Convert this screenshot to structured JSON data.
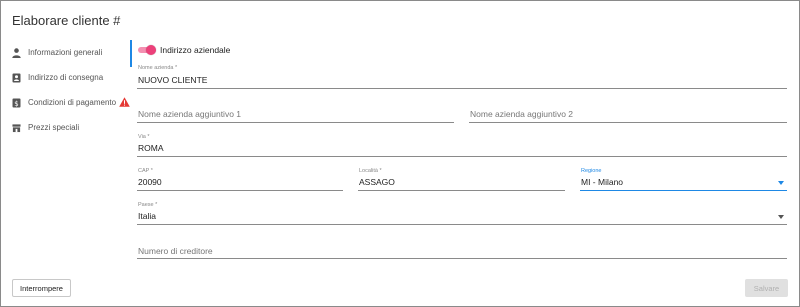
{
  "dialog": {
    "title": "Elaborare cliente #"
  },
  "sidebar": {
    "items": [
      {
        "label": "Informazioni generali",
        "icon": "person-icon"
      },
      {
        "label": "Indirizzo di consegna",
        "icon": "contact-card-icon"
      },
      {
        "label": "Condizioni di pagamento",
        "icon": "dollar-doc-icon",
        "warning_icon": "warning-icon"
      },
      {
        "label": "Prezzi speciali",
        "icon": "shop-icon"
      }
    ]
  },
  "form": {
    "toggle_label": "Indirizzo aziendale",
    "toggle_on": true,
    "company_name": {
      "label": "Nome azienda *",
      "value": "NUOVO CLIENTE"
    },
    "company_name_2": {
      "placeholder": "Nome azienda aggiuntivo 1"
    },
    "company_name_3": {
      "placeholder": "Nome azienda aggiuntivo 2"
    },
    "street": {
      "label": "Via *",
      "value": "ROMA"
    },
    "zip": {
      "label": "CAP *",
      "value": "20090"
    },
    "city": {
      "label": "Località *",
      "value": "ASSAGO"
    },
    "region": {
      "label": "Regione",
      "value": "MI - Milano"
    },
    "country": {
      "label": "Paese *",
      "value": "Italia"
    },
    "creditor_number": {
      "placeholder": "Numero di creditore"
    }
  },
  "footer": {
    "cancel_label": "Interrompere",
    "save_label": "Salvare"
  },
  "colors": {
    "accent": "#1e88e5",
    "toggle": "#ec407a",
    "warning": "#e53935"
  }
}
